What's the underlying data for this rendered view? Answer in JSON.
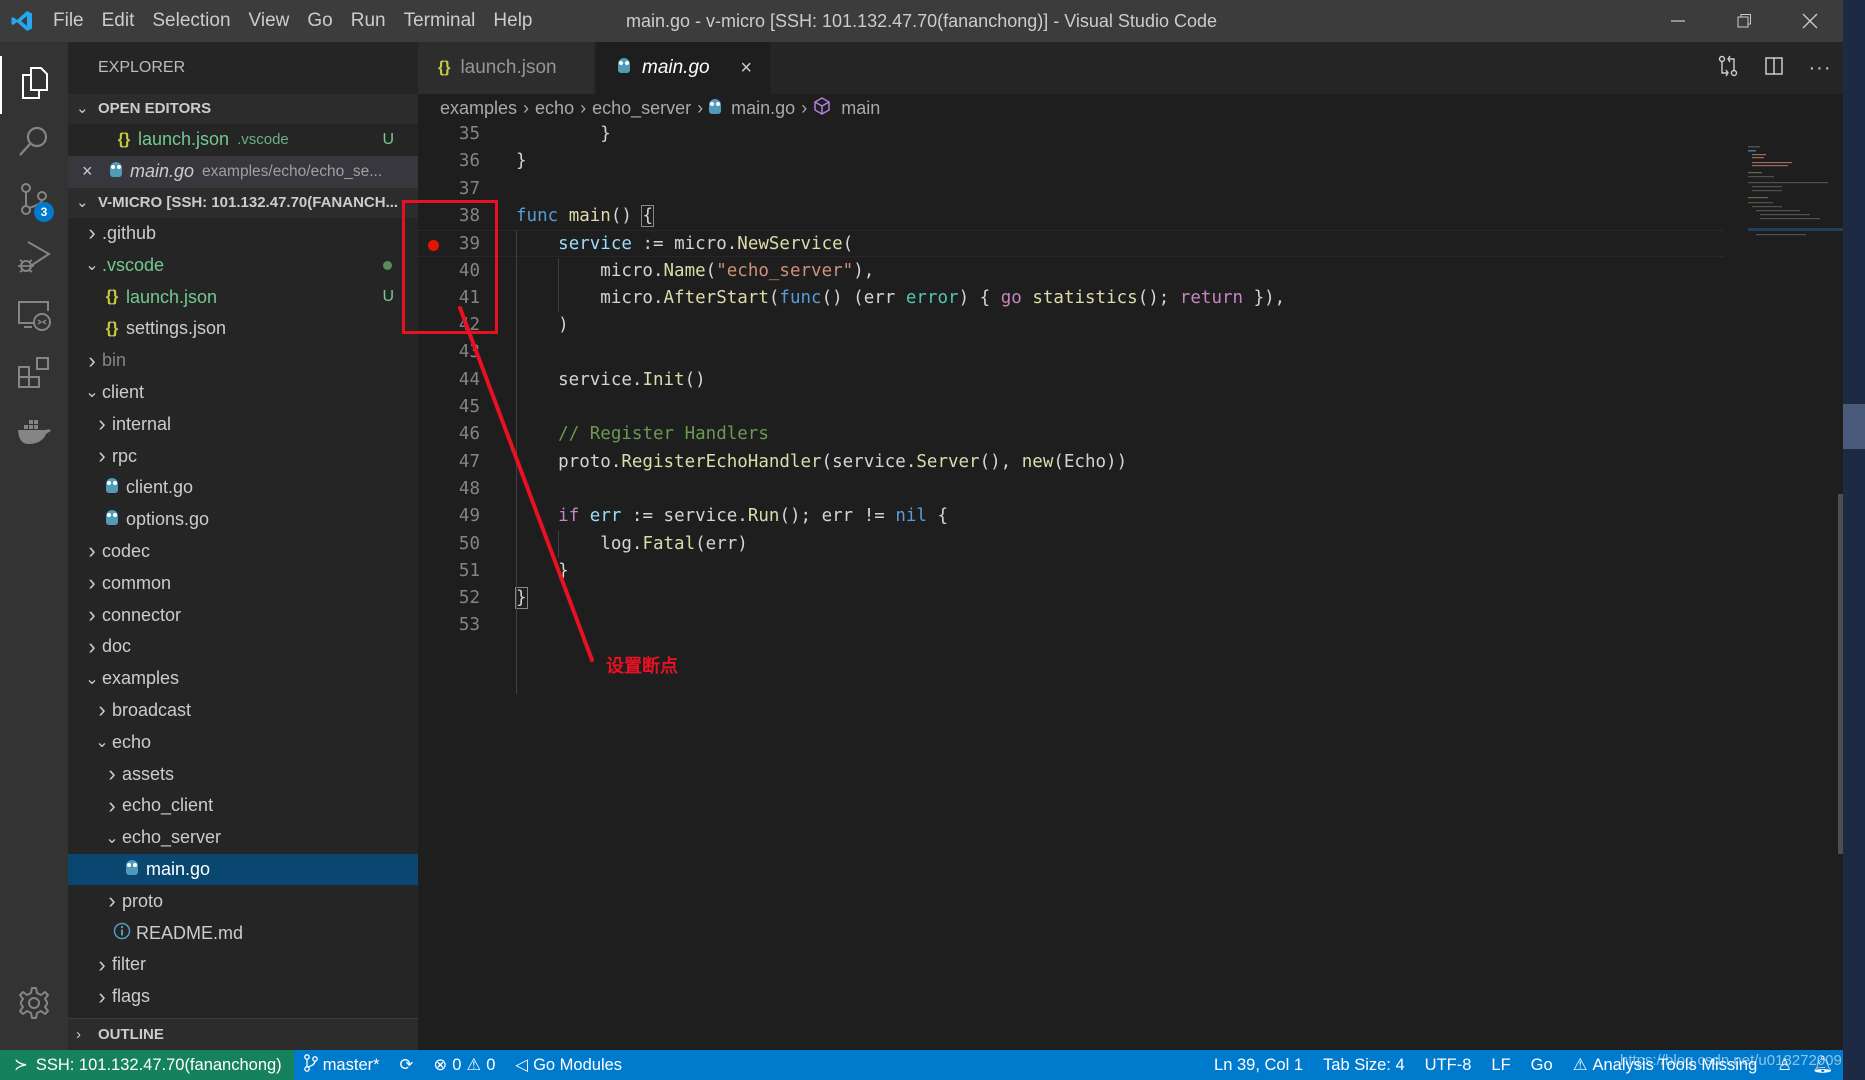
{
  "window": {
    "title": "main.go - v-micro [SSH: 101.132.47.70(fananchong)] - Visual Studio Code",
    "menu": [
      "File",
      "Edit",
      "Selection",
      "View",
      "Go",
      "Run",
      "Terminal",
      "Help"
    ]
  },
  "activity_bar": {
    "items": [
      {
        "name": "explorer",
        "icon": "files-icon",
        "active": true
      },
      {
        "name": "search",
        "icon": "search-icon"
      },
      {
        "name": "source-control",
        "icon": "source-control-icon",
        "badge": "3"
      },
      {
        "name": "run-debug",
        "icon": "debug-icon"
      },
      {
        "name": "remote-explorer",
        "icon": "remote-explorer-icon"
      },
      {
        "name": "extensions",
        "icon": "extensions-icon"
      },
      {
        "name": "docker",
        "icon": "docker-icon"
      }
    ],
    "settings_icon": "gear-icon"
  },
  "sidebar": {
    "title": "EXPLORER",
    "open_editors": {
      "label": "OPEN EDITORS",
      "items": [
        {
          "name": "launch.json",
          "desc": ".vscode",
          "decoration": "U",
          "icon": "json"
        },
        {
          "name": "main.go",
          "desc": "examples/echo/echo_se...",
          "icon": "go",
          "close": "×"
        }
      ]
    },
    "workspace": {
      "label": "V-MICRO [SSH: 101.132.47.70(FANANCH...",
      "tree": [
        {
          "label": ".github",
          "depth": 0,
          "type": "folder",
          "expanded": false
        },
        {
          "label": ".vscode",
          "depth": 0,
          "type": "folder",
          "expanded": true,
          "status": "modified-dot"
        },
        {
          "label": "launch.json",
          "depth": 1,
          "type": "json",
          "decoration": "U"
        },
        {
          "label": "settings.json",
          "depth": 1,
          "type": "json"
        },
        {
          "label": "bin",
          "depth": 0,
          "type": "folder",
          "expanded": false,
          "dim": true
        },
        {
          "label": "client",
          "depth": 0,
          "type": "folder",
          "expanded": true
        },
        {
          "label": "internal",
          "depth": 1,
          "type": "folder",
          "expanded": false
        },
        {
          "label": "rpc",
          "depth": 1,
          "type": "folder",
          "expanded": false
        },
        {
          "label": "client.go",
          "depth": 1,
          "type": "go"
        },
        {
          "label": "options.go",
          "depth": 1,
          "type": "go"
        },
        {
          "label": "codec",
          "depth": 0,
          "type": "folder",
          "expanded": false
        },
        {
          "label": "common",
          "depth": 0,
          "type": "folder",
          "expanded": false
        },
        {
          "label": "connector",
          "depth": 0,
          "type": "folder",
          "expanded": false
        },
        {
          "label": "doc",
          "depth": 0,
          "type": "folder",
          "expanded": false
        },
        {
          "label": "examples",
          "depth": 0,
          "type": "folder",
          "expanded": true
        },
        {
          "label": "broadcast",
          "depth": 1,
          "type": "folder",
          "expanded": false
        },
        {
          "label": "echo",
          "depth": 1,
          "type": "folder",
          "expanded": true
        },
        {
          "label": "assets",
          "depth": 2,
          "type": "folder",
          "expanded": false
        },
        {
          "label": "echo_client",
          "depth": 2,
          "type": "folder",
          "expanded": false
        },
        {
          "label": "echo_server",
          "depth": 2,
          "type": "folder",
          "expanded": true
        },
        {
          "label": "main.go",
          "depth": 3,
          "type": "go",
          "selected": true
        },
        {
          "label": "proto",
          "depth": 2,
          "type": "folder",
          "expanded": false
        },
        {
          "label": "README.md",
          "depth": 2,
          "type": "info"
        },
        {
          "label": "filter",
          "depth": 1,
          "type": "folder",
          "expanded": false
        },
        {
          "label": "flags",
          "depth": 1,
          "type": "folder",
          "expanded": false
        }
      ]
    },
    "outline_label": "OUTLINE"
  },
  "tabs": [
    {
      "label": "launch.json",
      "icon": "json",
      "active": false
    },
    {
      "label": "main.go",
      "icon": "go",
      "active": true,
      "close": "×"
    }
  ],
  "editor_actions": [
    "open-changes-icon",
    "split-editor-icon",
    "more-actions-icon"
  ],
  "breadcrumb": [
    "examples",
    "echo",
    "echo_server",
    "main.go",
    "main"
  ],
  "editor": {
    "breakpoint_line": 39,
    "current_line": 39,
    "lines": [
      {
        "n": 35,
        "tokens": [
          [
            "",
            "        "
          ],
          [
            "",
            "}"
          ]
        ]
      },
      {
        "n": 36,
        "tokens": [
          [
            "",
            "}"
          ]
        ]
      },
      {
        "n": 37,
        "tokens": []
      },
      {
        "n": 38,
        "tokens": [
          [
            "kw",
            "func"
          ],
          [
            "",
            " "
          ],
          [
            "fn",
            "main"
          ],
          [
            "",
            "() "
          ],
          [
            "brk",
            "{"
          ]
        ]
      },
      {
        "n": 39,
        "tokens": [
          [
            "",
            "    "
          ],
          [
            "var",
            "service"
          ],
          [
            "",
            " := micro."
          ],
          [
            "fn",
            "NewService"
          ],
          [
            "",
            "("
          ]
        ]
      },
      {
        "n": 40,
        "tokens": [
          [
            "",
            "        micro."
          ],
          [
            "fn",
            "Name"
          ],
          [
            "",
            "("
          ],
          [
            "str",
            "\"echo_server\""
          ],
          [
            "",
            "),"
          ]
        ]
      },
      {
        "n": 41,
        "tokens": [
          [
            "",
            "        micro."
          ],
          [
            "fn",
            "AfterStart"
          ],
          [
            "",
            "("
          ],
          [
            "kw",
            "func"
          ],
          [
            "",
            "() (err "
          ],
          [
            "ty",
            "error"
          ],
          [
            "",
            ") { "
          ],
          [
            "ctl",
            "go"
          ],
          [
            "",
            " "
          ],
          [
            "fn",
            "statistics"
          ],
          [
            "",
            "(); "
          ],
          [
            "ctl",
            "return"
          ],
          [
            "",
            " }),"
          ]
        ]
      },
      {
        "n": 42,
        "tokens": [
          [
            "",
            "    )"
          ]
        ]
      },
      {
        "n": 43,
        "tokens": []
      },
      {
        "n": 44,
        "tokens": [
          [
            "",
            "    service."
          ],
          [
            "fn",
            "Init"
          ],
          [
            "",
            "()"
          ]
        ]
      },
      {
        "n": 45,
        "tokens": []
      },
      {
        "n": 46,
        "tokens": [
          [
            "",
            "    "
          ],
          [
            "cm",
            "// Register Handlers"
          ]
        ]
      },
      {
        "n": 47,
        "tokens": [
          [
            "",
            "    proto."
          ],
          [
            "fn",
            "RegisterEchoHandler"
          ],
          [
            "",
            "(service."
          ],
          [
            "fn",
            "Server"
          ],
          [
            "",
            "(), "
          ],
          [
            "fn",
            "new"
          ],
          [
            "",
            "(Echo))"
          ]
        ]
      },
      {
        "n": 48,
        "tokens": []
      },
      {
        "n": 49,
        "tokens": [
          [
            "",
            "    "
          ],
          [
            "ctl",
            "if"
          ],
          [
            "",
            " "
          ],
          [
            "var",
            "err"
          ],
          [
            "",
            " := service."
          ],
          [
            "fn",
            "Run"
          ],
          [
            "",
            "(); err != "
          ],
          [
            "kw",
            "nil"
          ],
          [
            "",
            " {"
          ]
        ]
      },
      {
        "n": 50,
        "tokens": [
          [
            "",
            "        log."
          ],
          [
            "fn",
            "Fatal"
          ],
          [
            "",
            "(err)"
          ]
        ]
      },
      {
        "n": 51,
        "tokens": [
          [
            "",
            "    }"
          ]
        ]
      },
      {
        "n": 52,
        "tokens": [
          [
            "brk",
            "}"
          ]
        ]
      },
      {
        "n": 53,
        "tokens": []
      }
    ]
  },
  "annotation": {
    "text": "设置断点",
    "color": "#e81123"
  },
  "statusbar": {
    "remote": "SSH: 101.132.47.70(fananchong)",
    "branch": "master*",
    "errors": "0",
    "warnings": "0",
    "go_modules": "Go Modules",
    "position": "Ln 39, Col 1",
    "tab_size": "Tab Size: 4",
    "encoding": "UTF-8",
    "eol": "LF",
    "language": "Go",
    "analysis": "Analysis Tools Missing",
    "watermark": "https://blog.csdn.net/u013272009"
  },
  "colors": {
    "accent": "#007acc",
    "remote": "#16825d",
    "selection": "#094771",
    "breakpoint": "#e51400"
  }
}
